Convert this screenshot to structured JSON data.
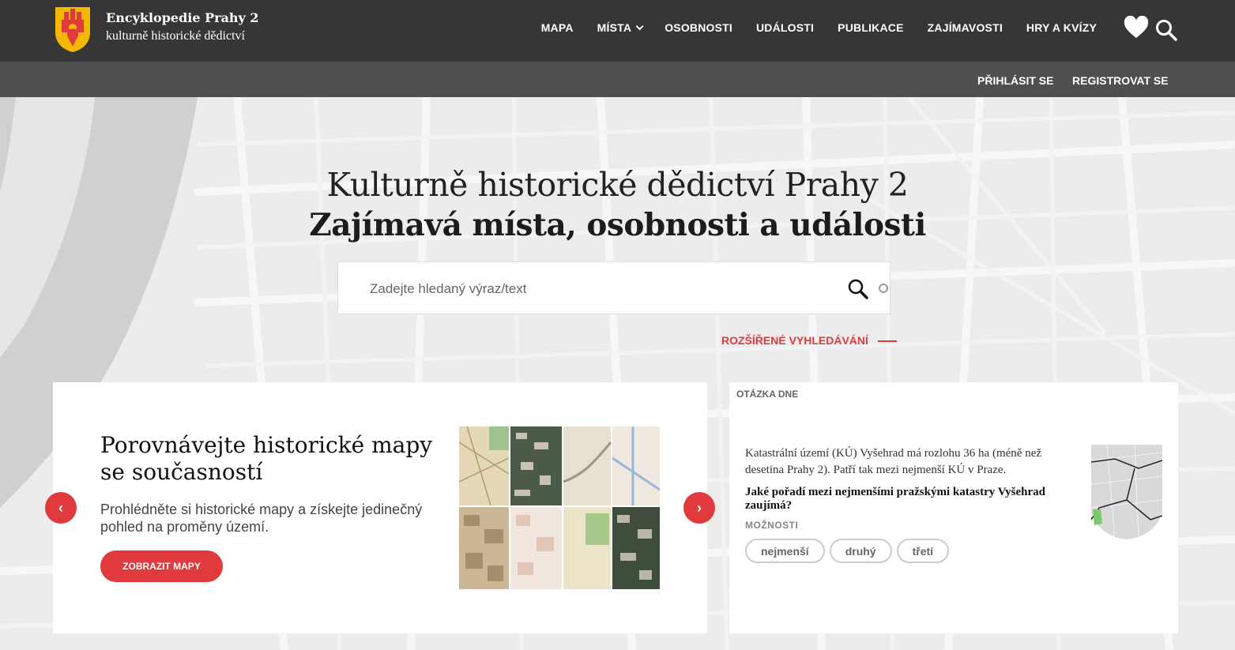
{
  "brand": {
    "title": "Encyklopedie Prahy 2",
    "subtitle": "kulturně historické dědictví"
  },
  "nav": [
    {
      "label": "MAPA"
    },
    {
      "label": "MÍSTA"
    },
    {
      "label": "OSOBNOSTI"
    },
    {
      "label": "UDÁLOSTI"
    },
    {
      "label": "PUBLIKACE"
    },
    {
      "label": "ZAJÍMAVOSTI"
    },
    {
      "label": "HRY A KVÍZY"
    }
  ],
  "account": {
    "login": "PŘIHLÁSIT SE",
    "register": "REGISTROVAT SE"
  },
  "hero": {
    "title": "Kulturně historické dědictví Prahy 2",
    "subtitle": "Zajímavá místa, osobnosti a události"
  },
  "search": {
    "placeholder": "Zadejte hledaný výraz/text",
    "advanced": "ROZŠÍŘENÉ VYHLEDÁVÁNÍ"
  },
  "slide": {
    "title": "Porovnávejte historické mapy se současností",
    "desc": "Prohlédněte si historické mapy a získejte jedinečný pohled na proměny území.",
    "button": "ZOBRAZIT MAPY",
    "prev": "‹",
    "next": "›"
  },
  "question": {
    "label": "OTÁZKA DNE",
    "intro": "Katastrální území (KÚ) Vyšehrad má rozlohu 36 ha (méně než desetina Prahy 2). Patří tak mezi nejmenší KÚ v Praze.",
    "question": "Jaké pořadí mezi nejmenšími pražskými katastry Vyšehrad zaujímá?",
    "options_label": "MOŽNOSTI",
    "options": [
      "nejmenší",
      "druhý",
      "třetí"
    ]
  },
  "colors": {
    "accent": "#e03a3e",
    "topbar": "#363636",
    "subbar": "#4f4f4f",
    "logo": "#f5b800"
  }
}
